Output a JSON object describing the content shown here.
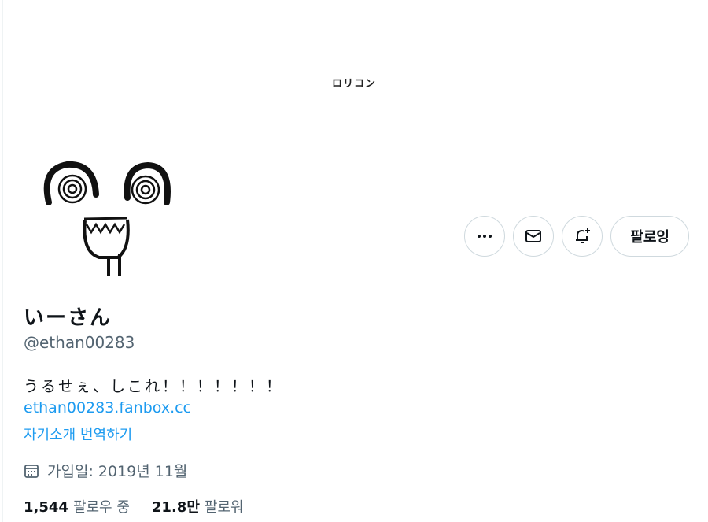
{
  "banner": {
    "text": "ロリコン"
  },
  "actions": {
    "more_icon": "more-icon",
    "message_icon": "mail-icon",
    "notify_icon": "bell-plus-icon",
    "following_label": "팔로잉"
  },
  "profile": {
    "display_name": "いーさん",
    "handle": "@ethan00283",
    "bio": "うるせぇ、しこれ！！！！！！！",
    "link": "ethan00283.fanbox.cc",
    "translate_label": "자기소개 번역하기",
    "joined": "가입일: 2019년 11월"
  },
  "stats": {
    "following_count": "1,544",
    "following_label": "팔로우 중",
    "followers_count": "21.8만",
    "followers_label": "팔로워"
  },
  "colors": {
    "accent": "#1d9bf0",
    "muted": "#536471",
    "border": "#cfd9de"
  }
}
